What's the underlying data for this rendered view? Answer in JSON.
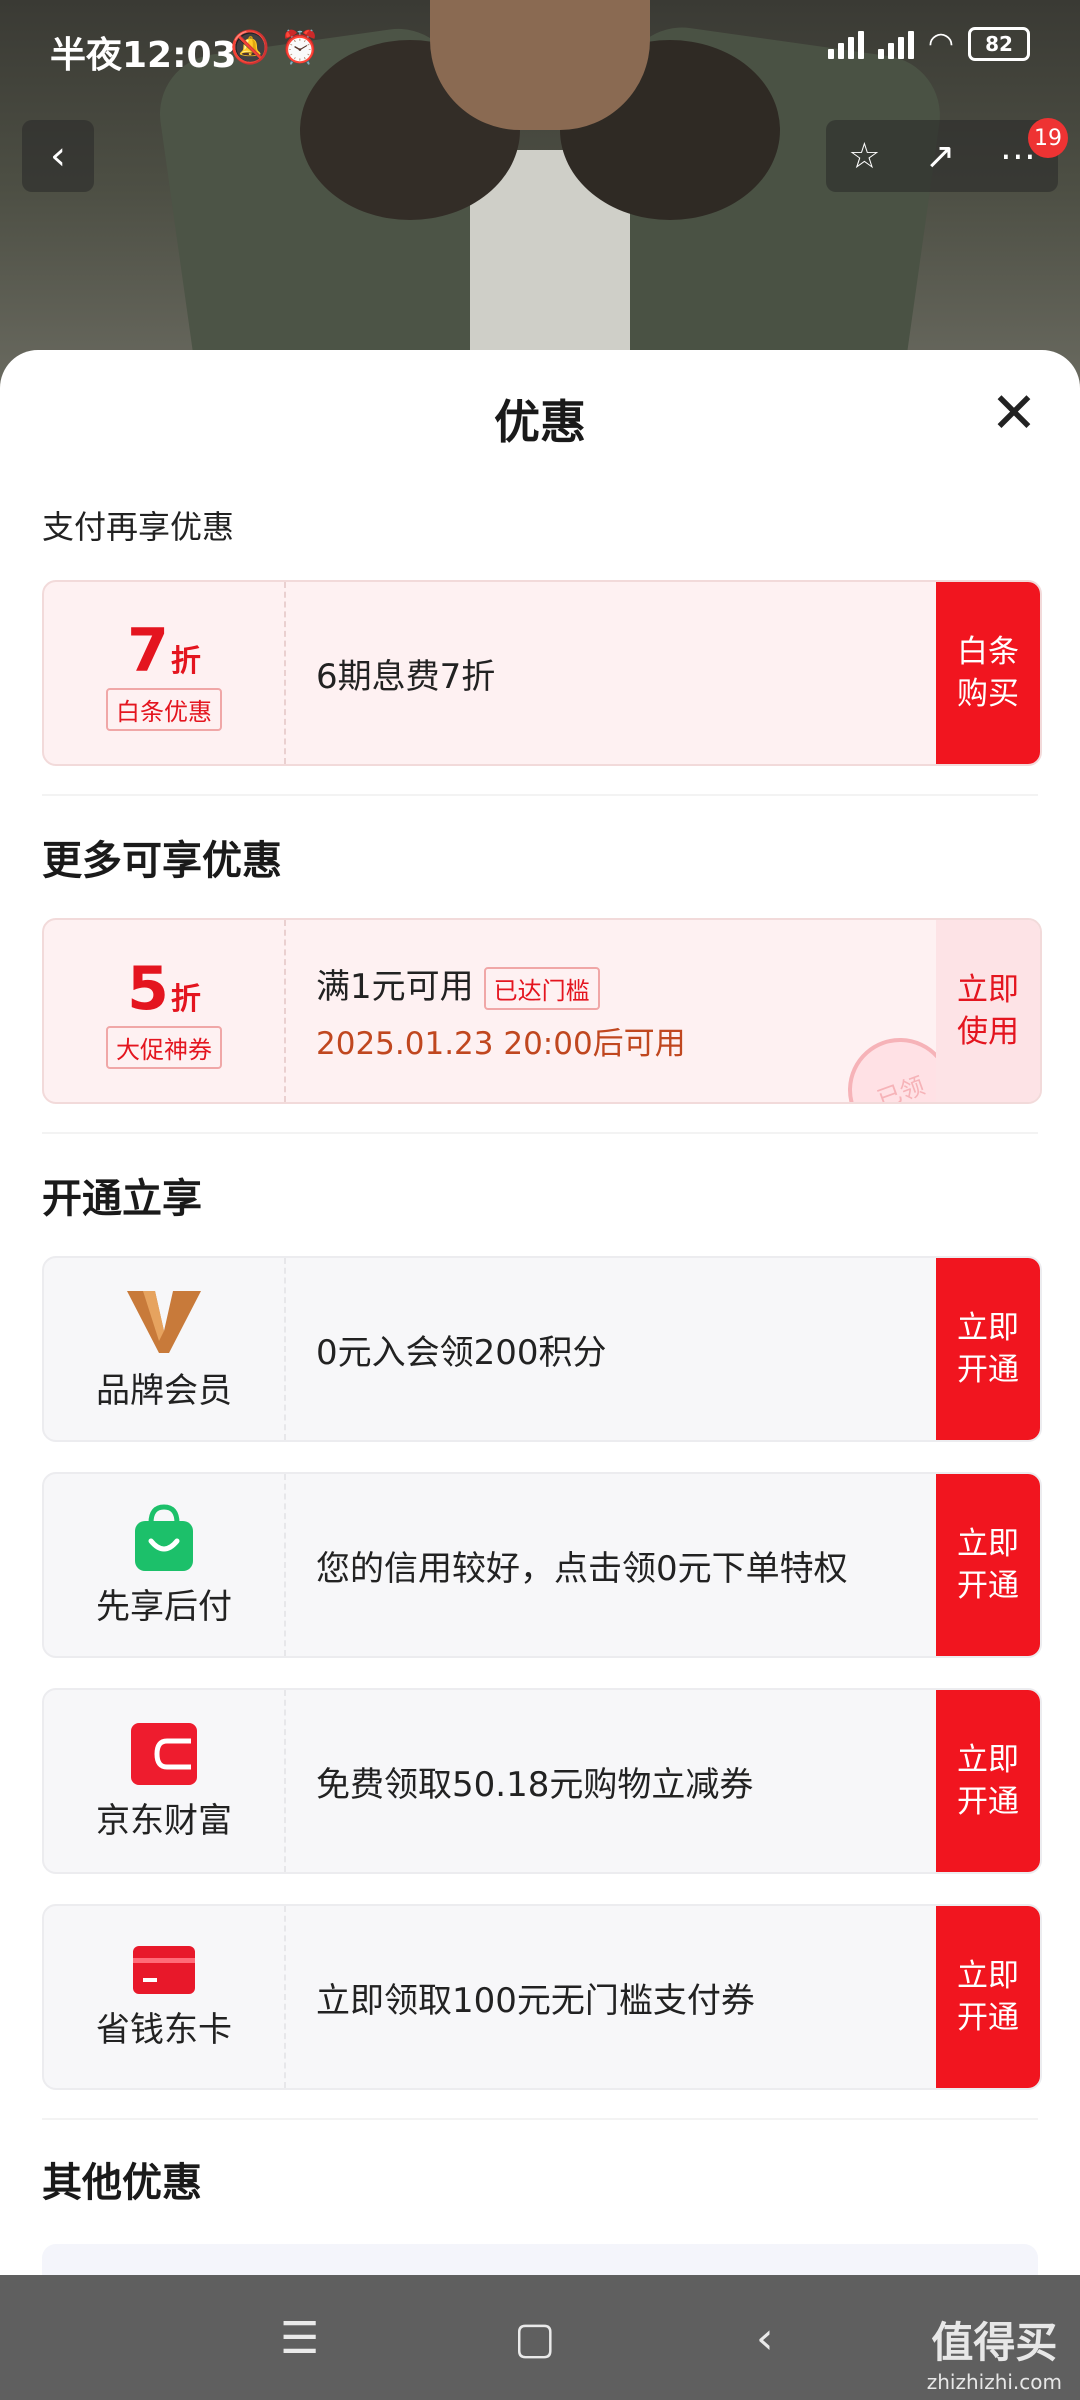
{
  "status_bar": {
    "time": "半夜12:03",
    "icons": "🔕 ⏰",
    "battery": "82",
    "network": "HD"
  },
  "top_bar": {
    "back": "‹",
    "star": "☆",
    "share": "↗",
    "more": "⋯",
    "badge": "19"
  },
  "sheet": {
    "title": "优惠",
    "close": "✕",
    "pay_section": "支付再享优惠",
    "pay_card": {
      "value": "7",
      "unit": "折",
      "tag": "白条优惠",
      "desc": "6期息费7折",
      "button": "白条\n购买"
    },
    "more_section": "更多可享优惠",
    "coupon_card": {
      "value": "5",
      "unit": "折",
      "tag": "大促神券",
      "desc": "满1元可用",
      "status": "已达门槛",
      "date": "2025.01.23 20:00后可用",
      "button": "立即\n使用",
      "stamp": "已领"
    },
    "open_section": "开通立享",
    "open_cards": [
      {
        "name": "品牌会员",
        "icon": "v-logo-icon",
        "desc": "0元入会领200积分",
        "button": "立即\n开通"
      },
      {
        "name": "先享后付",
        "icon": "shopping-bag-icon",
        "desc": "您的信用较好，点击领0元下单特权",
        "button": "立即\n开通"
      },
      {
        "name": "京东财富",
        "icon": "wallet-icon",
        "desc": "免费领取50.18元购物立减券",
        "button": "立即\n开通"
      },
      {
        "name": "省钱东卡",
        "icon": "card-icon",
        "desc": "立即领取100元无门槛支付券",
        "button": "立即\n开通"
      }
    ],
    "other_section": "其他优惠"
  },
  "nav": {
    "menu": "☰",
    "home": "▢",
    "back": "‹"
  },
  "watermark": {
    "main": "值得买",
    "sub": "zhizhizhi.com"
  },
  "colors": {
    "accent": "#f1151f",
    "coupon_bg": "#fef1f2"
  }
}
